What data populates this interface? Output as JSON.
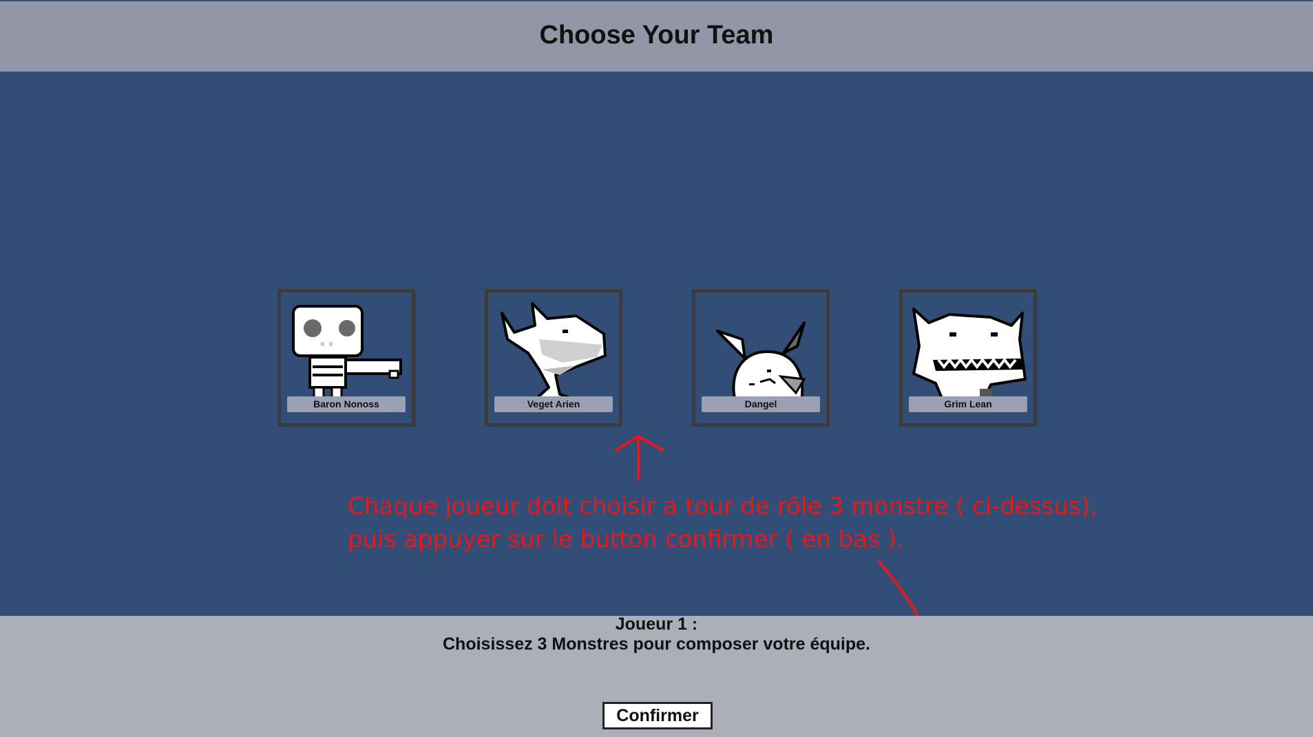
{
  "header": {
    "title": "Choose Your Team"
  },
  "monsters": [
    {
      "name": "Baron Nonoss",
      "icon": "skeleton-monster-icon"
    },
    {
      "name": "Veget Arien",
      "icon": "shark-monster-icon"
    },
    {
      "name": "Dangel",
      "icon": "rabbit-monster-icon"
    },
    {
      "name": "Grim Lean",
      "icon": "horned-monster-icon"
    }
  ],
  "annotation": {
    "line1": "Chaque joueur doit choisir a tour de rôle 3 monstre ( ci-dessus),",
    "line2": "puis appuyer sur le button confirmer ( en bas )."
  },
  "footer": {
    "player": "Joueur 1 :",
    "prompt": "Choisissez 3 Monstres pour composer votre équipe.",
    "confirm_label": "Confirmer"
  },
  "colors": {
    "background": "#324e76",
    "header": "#9197a6",
    "footer": "#acaeb8",
    "annotation": "#e3191d"
  }
}
